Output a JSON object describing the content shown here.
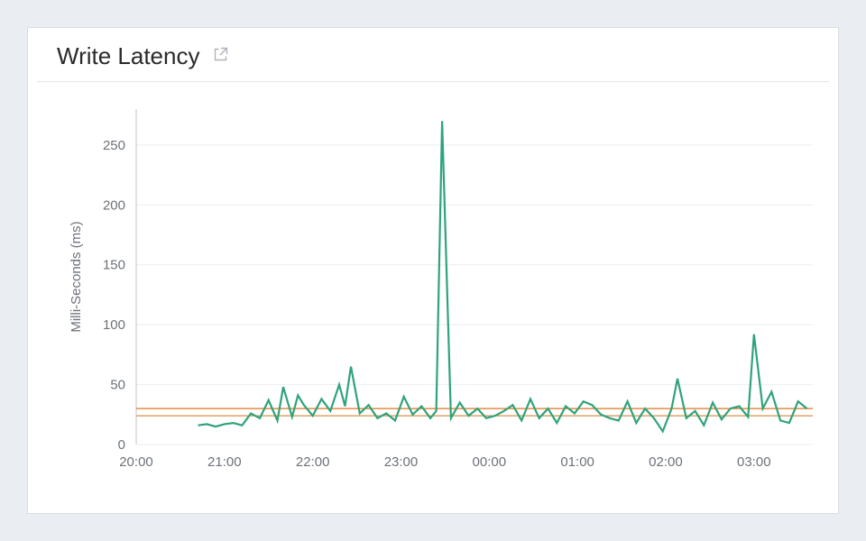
{
  "header": {
    "title": "Write Latency"
  },
  "chart_data": {
    "type": "line",
    "title": "Write Latency",
    "xlabel": "",
    "ylabel": "Milli-Seconds (ms)",
    "x_ticks": [
      "20:00",
      "21:00",
      "22:00",
      "23:00",
      "00:00",
      "01:00",
      "02:00",
      "03:00"
    ],
    "y_ticks": [
      0,
      50,
      100,
      150,
      200,
      250
    ],
    "ylim": [
      0,
      280
    ],
    "xlim_minutes": [
      0,
      460
    ],
    "reference_lines": [
      {
        "name": "ref-upper",
        "value": 30
      },
      {
        "name": "ref-lower",
        "value": 24
      }
    ],
    "series": [
      {
        "name": "Write Latency",
        "color": "#2fa37a",
        "points": [
          {
            "t": 42,
            "v": 16
          },
          {
            "t": 48,
            "v": 17
          },
          {
            "t": 54,
            "v": 15
          },
          {
            "t": 60,
            "v": 17
          },
          {
            "t": 66,
            "v": 18
          },
          {
            "t": 72,
            "v": 16
          },
          {
            "t": 78,
            "v": 26
          },
          {
            "t": 84,
            "v": 22
          },
          {
            "t": 90,
            "v": 37
          },
          {
            "t": 96,
            "v": 20
          },
          {
            "t": 100,
            "v": 48
          },
          {
            "t": 106,
            "v": 23
          },
          {
            "t": 110,
            "v": 41
          },
          {
            "t": 114,
            "v": 33
          },
          {
            "t": 120,
            "v": 24
          },
          {
            "t": 126,
            "v": 38
          },
          {
            "t": 132,
            "v": 28
          },
          {
            "t": 138,
            "v": 50
          },
          {
            "t": 142,
            "v": 32
          },
          {
            "t": 146,
            "v": 65
          },
          {
            "t": 152,
            "v": 26
          },
          {
            "t": 158,
            "v": 33
          },
          {
            "t": 164,
            "v": 22
          },
          {
            "t": 170,
            "v": 26
          },
          {
            "t": 176,
            "v": 20
          },
          {
            "t": 182,
            "v": 40
          },
          {
            "t": 188,
            "v": 25
          },
          {
            "t": 194,
            "v": 32
          },
          {
            "t": 200,
            "v": 22
          },
          {
            "t": 204,
            "v": 28
          },
          {
            "t": 208,
            "v": 270
          },
          {
            "t": 214,
            "v": 22
          },
          {
            "t": 220,
            "v": 35
          },
          {
            "t": 226,
            "v": 24
          },
          {
            "t": 232,
            "v": 30
          },
          {
            "t": 238,
            "v": 22
          },
          {
            "t": 244,
            "v": 24
          },
          {
            "t": 250,
            "v": 28
          },
          {
            "t": 256,
            "v": 33
          },
          {
            "t": 262,
            "v": 20
          },
          {
            "t": 268,
            "v": 38
          },
          {
            "t": 274,
            "v": 22
          },
          {
            "t": 280,
            "v": 30
          },
          {
            "t": 286,
            "v": 18
          },
          {
            "t": 292,
            "v": 32
          },
          {
            "t": 298,
            "v": 26
          },
          {
            "t": 304,
            "v": 36
          },
          {
            "t": 310,
            "v": 33
          },
          {
            "t": 316,
            "v": 25
          },
          {
            "t": 322,
            "v": 22
          },
          {
            "t": 328,
            "v": 20
          },
          {
            "t": 334,
            "v": 36
          },
          {
            "t": 340,
            "v": 18
          },
          {
            "t": 346,
            "v": 30
          },
          {
            "t": 352,
            "v": 22
          },
          {
            "t": 358,
            "v": 11
          },
          {
            "t": 364,
            "v": 30
          },
          {
            "t": 368,
            "v": 55
          },
          {
            "t": 374,
            "v": 22
          },
          {
            "t": 380,
            "v": 28
          },
          {
            "t": 386,
            "v": 16
          },
          {
            "t": 392,
            "v": 35
          },
          {
            "t": 398,
            "v": 21
          },
          {
            "t": 404,
            "v": 30
          },
          {
            "t": 410,
            "v": 32
          },
          {
            "t": 416,
            "v": 23
          },
          {
            "t": 420,
            "v": 92
          },
          {
            "t": 426,
            "v": 30
          },
          {
            "t": 432,
            "v": 44
          },
          {
            "t": 438,
            "v": 20
          },
          {
            "t": 444,
            "v": 18
          },
          {
            "t": 450,
            "v": 36
          },
          {
            "t": 456,
            "v": 30
          }
        ]
      }
    ]
  }
}
